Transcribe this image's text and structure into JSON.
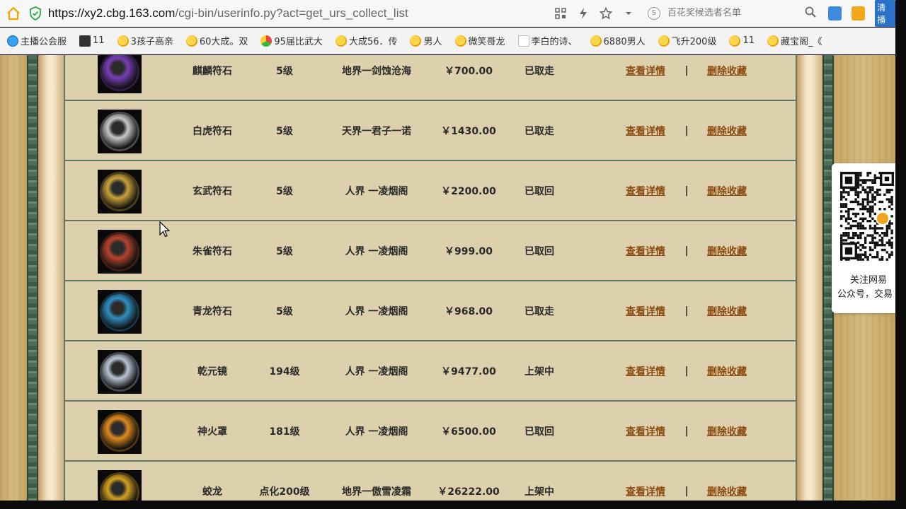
{
  "browser": {
    "url_host": "https://xy2.cbg.163.com",
    "url_path": "/cgi-bin/userinfo.py?act=get_urs_collect_list",
    "search_placeholder": "百花奖候选者名单",
    "ext_label": "清播"
  },
  "bookmarks": [
    {
      "label": "主播公会服",
      "icon": "blue"
    },
    {
      "label": "11",
      "icon": "dark"
    },
    {
      "label": "3孩子高亲",
      "icon": "duck"
    },
    {
      "label": "60大成。双",
      "icon": "duck"
    },
    {
      "label": "95届比武大",
      "icon": "chrome"
    },
    {
      "label": "大成56．传",
      "icon": "duck"
    },
    {
      "label": "男人",
      "icon": "duck"
    },
    {
      "label": "微笑哥龙",
      "icon": "duck"
    },
    {
      "label": "李白的诗、",
      "icon": "leaf"
    },
    {
      "label": "6880男人",
      "icon": "duck"
    },
    {
      "label": "飞升200级",
      "icon": "duck"
    },
    {
      "label": "11",
      "icon": "duck"
    },
    {
      "label": "藏宝阁_《",
      "icon": "duck"
    }
  ],
  "rows": [
    {
      "name": "麒麟符石",
      "level": "5级",
      "server": "地界一剑蚀沧海",
      "price": "￥700.00",
      "status": "已取走",
      "detail": "查看详情",
      "sep": "|",
      "delete": "删除收藏",
      "color": "#7a3fb8"
    },
    {
      "name": "白虎符石",
      "level": "5级",
      "server": "天界一君子一诺",
      "price": "￥1430.00",
      "status": "已取走",
      "detail": "查看详情",
      "sep": "|",
      "delete": "删除收藏",
      "color": "#c8c8c8"
    },
    {
      "name": "玄武符石",
      "level": "5级",
      "server": "人界 一凌烟阁",
      "price": "￥2200.00",
      "status": "已取回",
      "detail": "查看详情",
      "sep": "|",
      "delete": "删除收藏",
      "color": "#c9a23a"
    },
    {
      "name": "朱雀符石",
      "level": "5级",
      "server": "人界 一凌烟阁",
      "price": "￥999.00",
      "status": "已取回",
      "detail": "查看详情",
      "sep": "|",
      "delete": "删除收藏",
      "color": "#b5442c"
    },
    {
      "name": "青龙符石",
      "level": "5级",
      "server": "人界 一凌烟阁",
      "price": "￥968.00",
      "status": "已取走",
      "detail": "查看详情",
      "sep": "|",
      "delete": "删除收藏",
      "color": "#2f8fc0"
    },
    {
      "name": "乾元镜",
      "level": "194级",
      "server": "人界 一凌烟阁",
      "price": "￥9477.00",
      "status": "上架中",
      "detail": "查看详情",
      "sep": "|",
      "delete": "删除收藏",
      "color": "#b9c4d4"
    },
    {
      "name": "神火罩",
      "level": "181级",
      "server": "人界 一凌烟阁",
      "price": "￥6500.00",
      "status": "已取回",
      "detail": "查看详情",
      "sep": "|",
      "delete": "删除收藏",
      "color": "#e08a1e"
    },
    {
      "name": "蛟龙",
      "level": "点化200级",
      "server": "地界一傲雪凌霜",
      "price": "￥26222.00",
      "status": "上架中",
      "detail": "查看详情",
      "sep": "|",
      "delete": "删除收藏",
      "color": "#d4a020"
    }
  ],
  "qr_panel": {
    "line1": "关注网易",
    "line2": "公众号，交易"
  }
}
